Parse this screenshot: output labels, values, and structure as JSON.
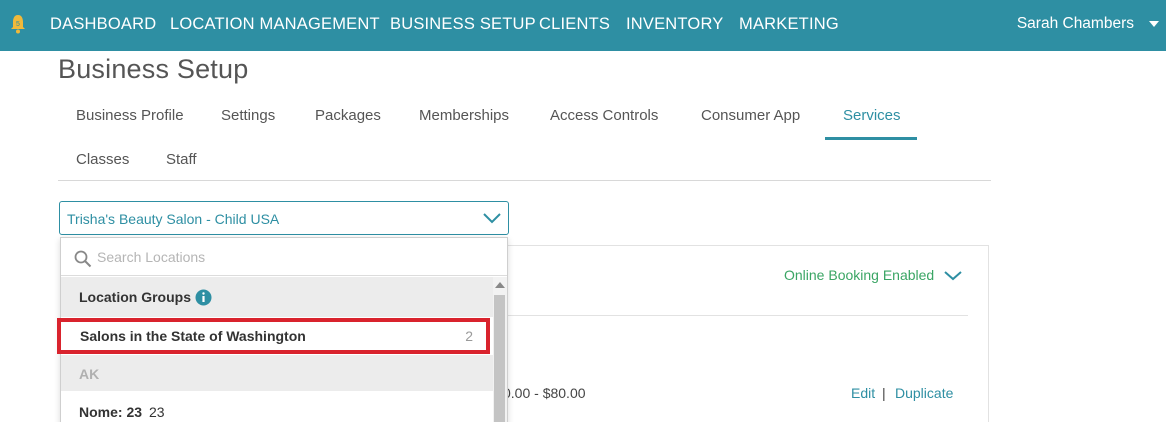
{
  "nav": {
    "items": [
      "DASHBOARD",
      "LOCATION MANAGEMENT",
      "BUSINESS SETUP",
      "CLIENTS",
      "INVENTORY",
      "MARKETING"
    ],
    "user_name": "Sarah Chambers",
    "bell_icon": "bell-icon",
    "bg_color": "#2e8fa3"
  },
  "page": {
    "title": "Business Setup"
  },
  "tabs": {
    "row1": [
      "Business Profile",
      "Settings",
      "Packages",
      "Memberships",
      "Access Controls",
      "Consumer App",
      "Services"
    ],
    "row2": [
      "Classes",
      "Staff"
    ],
    "active": "Services"
  },
  "location_select": {
    "value": "Trisha's Beauty Salon - Child USA",
    "search_placeholder": "Search Locations",
    "group_header": "Location Groups",
    "groups": [
      {
        "label": "Salons in the State of Washington",
        "count": "2"
      }
    ],
    "region": "AK",
    "locations": [
      {
        "label": "Nome: 23",
        "suffix": "23"
      }
    ]
  },
  "card": {
    "booking_status": "Online Booking Enabled",
    "price_range": "0.00 - $80.00",
    "edit_label": "Edit",
    "separator": "|",
    "duplicate_label": "Duplicate"
  },
  "colors": {
    "accent": "#2e8fa3",
    "success": "#3aa564",
    "highlight": "#d9232d"
  }
}
